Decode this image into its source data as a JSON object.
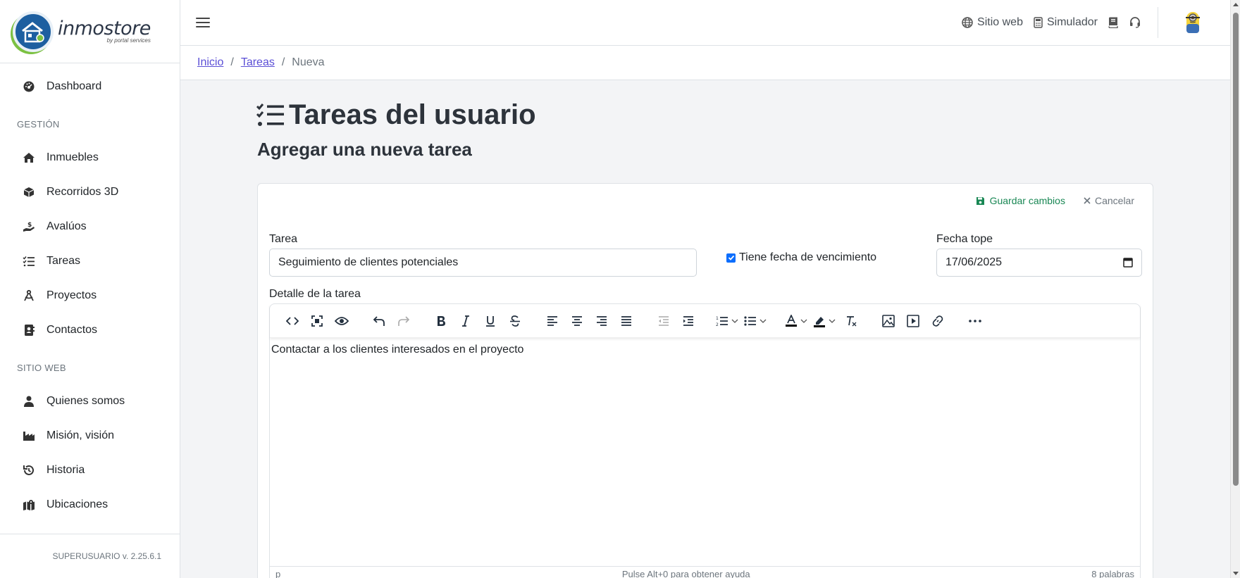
{
  "app": {
    "brand": "inmostore",
    "brand_sub": "by portal services"
  },
  "sidebar": {
    "dashboard": "Dashboard",
    "section_gestion": "GESTIÓN",
    "gestion_items": [
      {
        "label": "Inmuebles",
        "icon": "home-icon"
      },
      {
        "label": "Recorridos 3D",
        "icon": "cube-icon"
      },
      {
        "label": "Avalúos",
        "icon": "hand-money-icon"
      },
      {
        "label": "Tareas",
        "icon": "task-list-icon"
      },
      {
        "label": "Proyectos",
        "icon": "compass-icon"
      },
      {
        "label": "Contactos",
        "icon": "address-book-icon"
      }
    ],
    "section_web": "SITIO WEB",
    "web_items": [
      {
        "label": "Quienes somos",
        "icon": "user-icon"
      },
      {
        "label": "Misión, visión",
        "icon": "industry-icon"
      },
      {
        "label": "Historia",
        "icon": "history-icon"
      },
      {
        "label": "Ubicaciones",
        "icon": "map-icon"
      }
    ],
    "footer": "SUPERUSUARIO v. 2.25.6.1"
  },
  "topbar": {
    "sitio_web": "Sitio web",
    "simulador": "Simulador"
  },
  "breadcrumb": {
    "inicio": "Inicio",
    "tareas": "Tareas",
    "current": "Nueva"
  },
  "page": {
    "title": "Tareas del usuario",
    "subtitle": "Agregar una nueva tarea"
  },
  "form": {
    "save_label": "Guardar cambios",
    "cancel_label": "Cancelar",
    "tarea_label": "Tarea",
    "tarea_value": "Seguimiento de clientes potenciales",
    "has_due_label": "Tiene fecha de vencimiento",
    "has_due_checked": true,
    "fecha_label": "Fecha tope",
    "fecha_value": "17/06/2025",
    "detalle_label": "Detalle de la tarea",
    "detalle_value": "Contactar a los clientes interesados en el proyecto"
  },
  "editor_status": {
    "path": "p",
    "help": "Pulse Alt+0 para obtener ayuda",
    "words": "8 palabras"
  },
  "colors": {
    "save": "#198754",
    "link": "#5b4fd6",
    "checkbox": "#0d6efd"
  }
}
